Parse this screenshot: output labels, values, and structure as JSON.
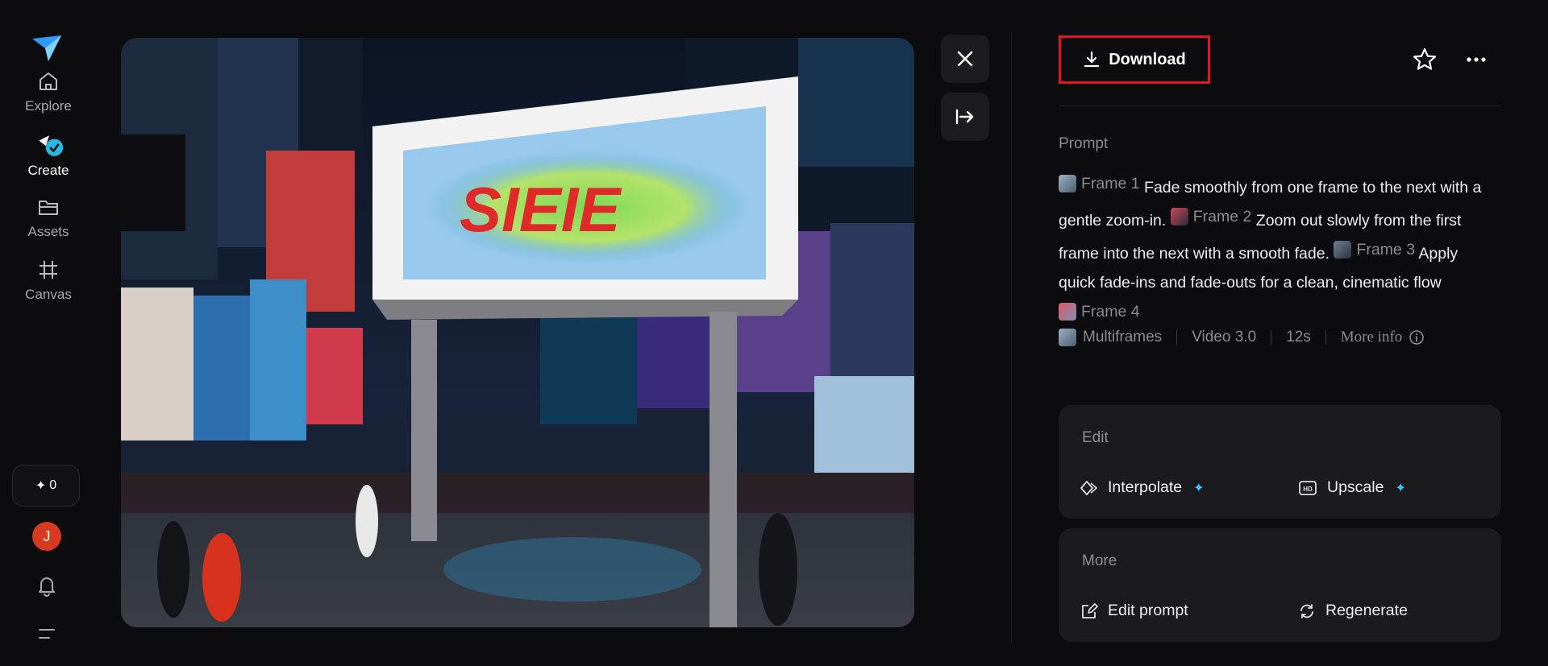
{
  "sidebar": {
    "items": [
      {
        "label": "Explore",
        "icon": "home-icon"
      },
      {
        "label": "Create",
        "icon": "create-icon"
      },
      {
        "label": "Assets",
        "icon": "folder-icon"
      },
      {
        "label": "Canvas",
        "icon": "frame-icon"
      }
    ],
    "credits": "0",
    "avatar_initial": "J"
  },
  "header": {
    "download_label": "Download"
  },
  "prompt": {
    "title": "Prompt",
    "frame1": "Frame 1",
    "text1": "Fade smoothly from one frame to the next with a gentle zoom-in.",
    "frame2": "Frame 2",
    "text2": "Zoom out slowly from the first frame into the next with a smooth fade.",
    "frame3": "Frame 3",
    "text3": "Apply quick fade-ins and fade-outs for a clean, cinematic flow",
    "frame4": "Frame 4"
  },
  "meta": {
    "mode": "Multiframes",
    "model": "Video 3.0",
    "duration": "12s",
    "more_info": "More info"
  },
  "edit": {
    "title": "Edit",
    "interpolate": "Interpolate",
    "upscale": "Upscale"
  },
  "more": {
    "title": "More",
    "edit_prompt": "Edit prompt",
    "regenerate": "Regenerate"
  },
  "colors": {
    "accent": "#3cc9ff",
    "highlight": "#e0161e",
    "avatar": "#d63b1f"
  }
}
